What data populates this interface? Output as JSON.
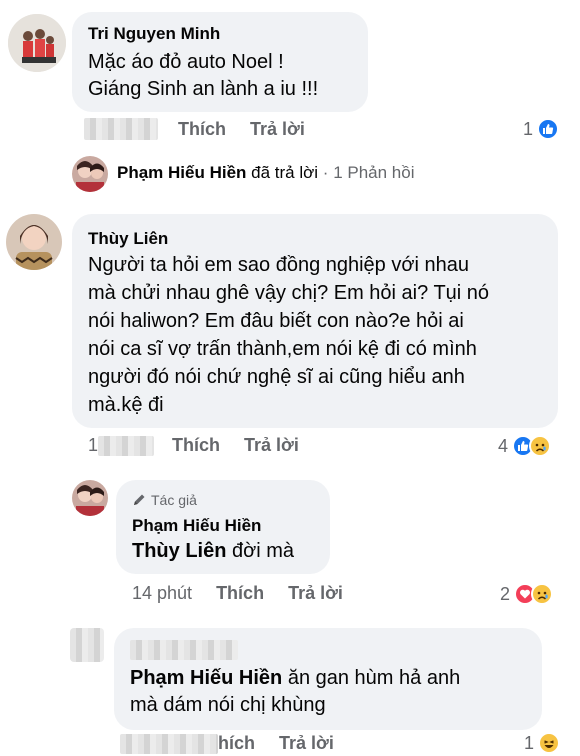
{
  "comment1": {
    "author": "Tri Nguyen Minh",
    "line1": "Mặc áo đỏ auto Noel !",
    "line2": "Giáng Sinh an lành a iu !!!",
    "like": "Thích",
    "reply": "Trả lời",
    "reaction_count": "1",
    "reactions": [
      "like-icon"
    ]
  },
  "reply_summary": {
    "name": "Phạm Hiếu Hiền",
    "action": "đã trả lời",
    "separator": "·",
    "count": "1 Phản hồi"
  },
  "comment2": {
    "author": "Thùy Liên",
    "lines": [
      "Người ta hỏi em sao đồng nghiệp với nhau",
      "mà chửi nhau ghê vậy chị? Em hỏi ai? Tụi nó",
      "nói haliwon? Em đâu biết con nào?e hỏi ai",
      "nói  ca sĩ vợ trấn thành,em nói kệ đi có mình",
      "người đó nói chứ nghệ sĩ ai cũng hiểu anh",
      "mà.kệ đi"
    ],
    "time": "1",
    "like": "Thích",
    "reply": "Trả lời",
    "reaction_count": "4",
    "reactions": [
      "like-icon",
      "sad-icon"
    ]
  },
  "reply1": {
    "badge": "Tác giả",
    "author": "Phạm Hiếu Hiền",
    "mention": "Thùy Liên",
    "text": " đời mà",
    "time": "14 phút",
    "like": "Thích",
    "reply": "Trả lời",
    "reaction_count": "2",
    "reactions": [
      "love-icon",
      "sad-icon"
    ]
  },
  "reply2": {
    "mention": "Phạm Hiếu Hiền",
    "text1": " ăn  gan hùm  hả  anh",
    "line2": "mà  dám  nói  chị khùng",
    "like": "hích",
    "reply": "Trả lời",
    "reaction_count": "1",
    "reactions": [
      "haha-icon"
    ]
  },
  "colors": {
    "bubble": "#f0f2f5",
    "meta": "#65676b",
    "like_blue": "#1877f2",
    "love_red": "#f33e58",
    "emoji_yellow": "#f7c342"
  }
}
